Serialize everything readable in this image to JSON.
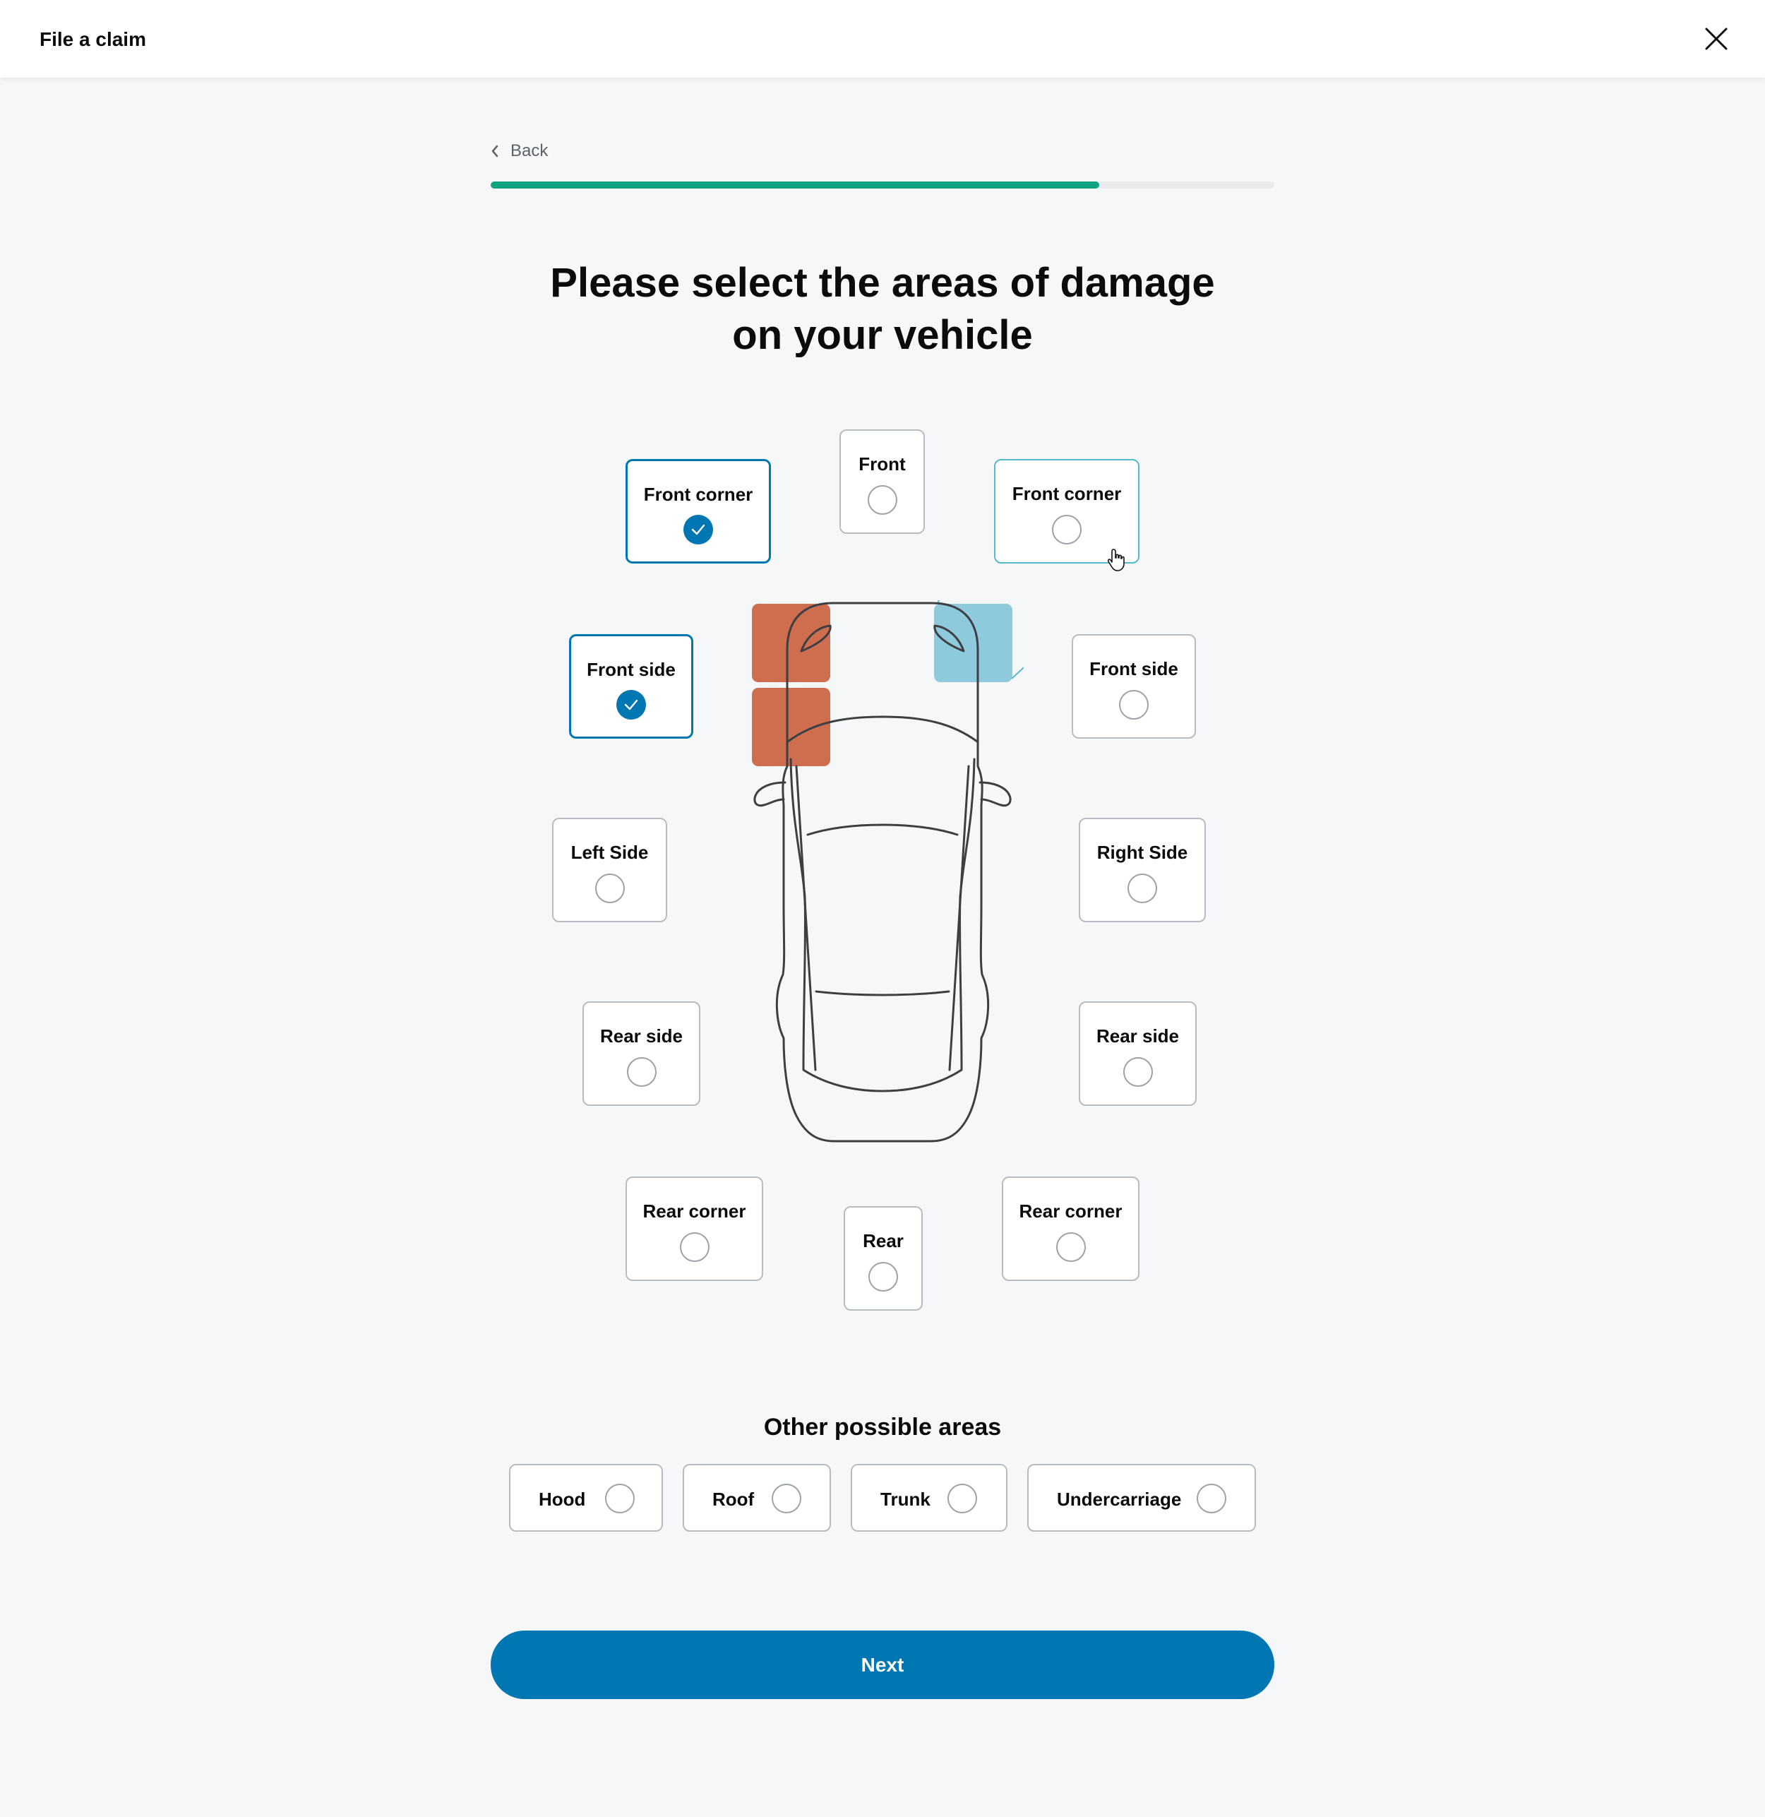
{
  "header": {
    "title": "File a claim",
    "close_icon": "close-icon"
  },
  "nav": {
    "back_label": "Back",
    "back_icon": "chevron-left-icon"
  },
  "progress": {
    "value": 0.777,
    "color": "#11a37f"
  },
  "heading": {
    "line1": "Please select the areas of damage",
    "line2": "on your vehicle"
  },
  "vehicle_areas": [
    {
      "key": "front-corner-left",
      "label": "Front corner",
      "state": "selected"
    },
    {
      "key": "front",
      "label": "Front",
      "state": "unselected"
    },
    {
      "key": "front-corner-right",
      "label": "Front corner",
      "state": "hover"
    },
    {
      "key": "front-side-left",
      "label": "Front side",
      "state": "selected"
    },
    {
      "key": "front-side-right",
      "label": "Front side",
      "state": "unselected"
    },
    {
      "key": "left-side",
      "label": "Left Side",
      "state": "unselected"
    },
    {
      "key": "right-side",
      "label": "Right Side",
      "state": "unselected"
    },
    {
      "key": "rear-side-left",
      "label": "Rear side",
      "state": "unselected"
    },
    {
      "key": "rear-side-right",
      "label": "Rear side",
      "state": "unselected"
    },
    {
      "key": "rear-corner-left",
      "label": "Rear corner",
      "state": "unselected"
    },
    {
      "key": "rear",
      "label": "Rear",
      "state": "unselected"
    },
    {
      "key": "rear-corner-right",
      "label": "Rear corner",
      "state": "unselected"
    }
  ],
  "other": {
    "title": "Other possible areas",
    "items": [
      {
        "label": "Hood",
        "state": "unselected"
      },
      {
        "label": "Roof",
        "state": "unselected"
      },
      {
        "label": "Trunk",
        "state": "unselected"
      },
      {
        "label": "Undercarriage",
        "state": "unselected"
      }
    ]
  },
  "cta": {
    "next_label": "Next"
  },
  "colors": {
    "accent": "#0077b3",
    "damage_selected": "#cf6e4f",
    "damage_hover": "#8ec9dc",
    "hover_border": "#55b7d3"
  }
}
